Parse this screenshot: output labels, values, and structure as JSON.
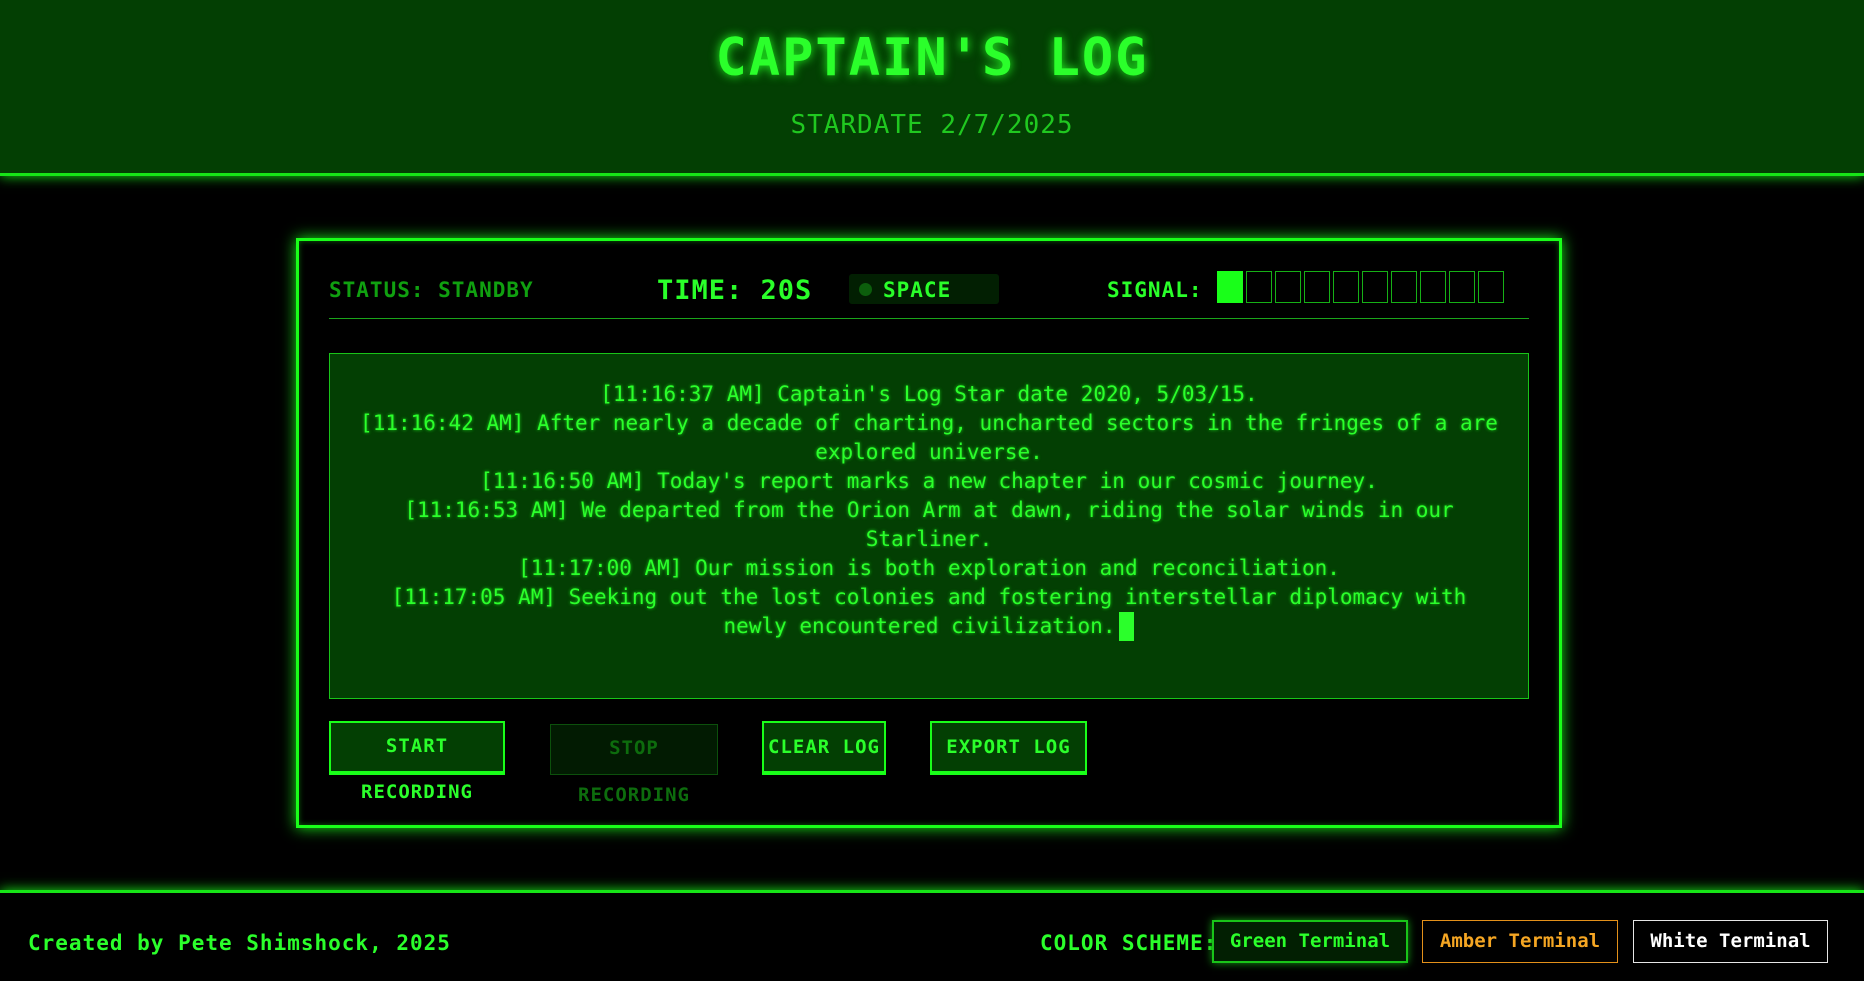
{
  "header": {
    "title": "CAPTAIN'S LOG",
    "stardate": "STARDATE 2/7/2025"
  },
  "status": {
    "status_text": "STATUS: STANDBY",
    "time_text": "TIME: 20S",
    "mode_label": "SPACE",
    "signal_label": "SIGNAL:",
    "signal_level": 1,
    "signal_total": 10
  },
  "log": {
    "lines": [
      "[11:16:37 AM] Captain's Log Star date 2020, 5/03/15.",
      "[11:16:42 AM] After nearly a decade of charting, uncharted sectors in the fringes of a are explored universe.",
      "[11:16:50 AM] Today's report marks a new chapter in our cosmic journey.",
      "[11:16:53 AM] We departed from the Orion Arm at dawn, riding the solar winds in our Starliner.",
      "[11:17:00 AM] Our mission is both exploration and reconciliation.",
      "[11:17:05 AM] Seeking out the lost colonies and fostering interstellar diplomacy with newly encountered civilization."
    ]
  },
  "controls": {
    "start_label": "START RECORDING",
    "stop_label": "STOP RECORDING",
    "clear_label": "CLEAR LOG",
    "export_label": "EXPORT LOG"
  },
  "footer": {
    "credit": "Created by Pete Shimshock, 2025",
    "scheme_label": "COLOR SCHEME:",
    "schemes": [
      "Green Terminal",
      "Amber Terminal",
      "White Terminal"
    ]
  },
  "colors": {
    "accent": "#19ff19",
    "background": "#000000",
    "panel_fill": "#033f03",
    "amber": "#f5a623",
    "white": "#ffffff"
  }
}
